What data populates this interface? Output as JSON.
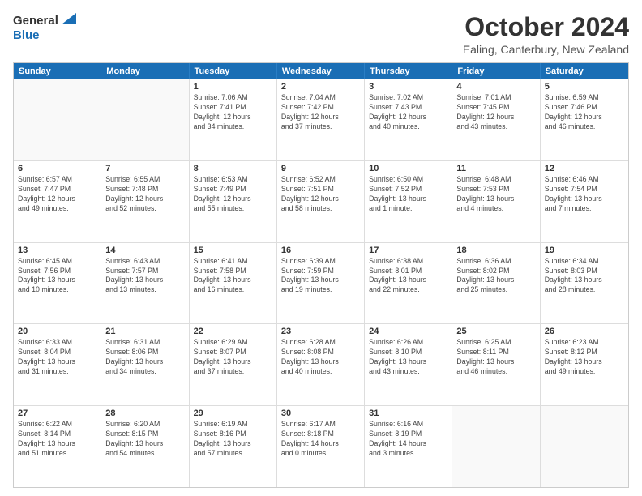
{
  "header": {
    "logo_general": "General",
    "logo_blue": "Blue",
    "month_title": "October 2024",
    "location": "Ealing, Canterbury, New Zealand"
  },
  "weekdays": [
    "Sunday",
    "Monday",
    "Tuesday",
    "Wednesday",
    "Thursday",
    "Friday",
    "Saturday"
  ],
  "rows": [
    [
      {
        "day": "",
        "info": ""
      },
      {
        "day": "",
        "info": ""
      },
      {
        "day": "1",
        "info": "Sunrise: 7:06 AM\nSunset: 7:41 PM\nDaylight: 12 hours\nand 34 minutes."
      },
      {
        "day": "2",
        "info": "Sunrise: 7:04 AM\nSunset: 7:42 PM\nDaylight: 12 hours\nand 37 minutes."
      },
      {
        "day": "3",
        "info": "Sunrise: 7:02 AM\nSunset: 7:43 PM\nDaylight: 12 hours\nand 40 minutes."
      },
      {
        "day": "4",
        "info": "Sunrise: 7:01 AM\nSunset: 7:45 PM\nDaylight: 12 hours\nand 43 minutes."
      },
      {
        "day": "5",
        "info": "Sunrise: 6:59 AM\nSunset: 7:46 PM\nDaylight: 12 hours\nand 46 minutes."
      }
    ],
    [
      {
        "day": "6",
        "info": "Sunrise: 6:57 AM\nSunset: 7:47 PM\nDaylight: 12 hours\nand 49 minutes."
      },
      {
        "day": "7",
        "info": "Sunrise: 6:55 AM\nSunset: 7:48 PM\nDaylight: 12 hours\nand 52 minutes."
      },
      {
        "day": "8",
        "info": "Sunrise: 6:53 AM\nSunset: 7:49 PM\nDaylight: 12 hours\nand 55 minutes."
      },
      {
        "day": "9",
        "info": "Sunrise: 6:52 AM\nSunset: 7:51 PM\nDaylight: 12 hours\nand 58 minutes."
      },
      {
        "day": "10",
        "info": "Sunrise: 6:50 AM\nSunset: 7:52 PM\nDaylight: 13 hours\nand 1 minute."
      },
      {
        "day": "11",
        "info": "Sunrise: 6:48 AM\nSunset: 7:53 PM\nDaylight: 13 hours\nand 4 minutes."
      },
      {
        "day": "12",
        "info": "Sunrise: 6:46 AM\nSunset: 7:54 PM\nDaylight: 13 hours\nand 7 minutes."
      }
    ],
    [
      {
        "day": "13",
        "info": "Sunrise: 6:45 AM\nSunset: 7:56 PM\nDaylight: 13 hours\nand 10 minutes."
      },
      {
        "day": "14",
        "info": "Sunrise: 6:43 AM\nSunset: 7:57 PM\nDaylight: 13 hours\nand 13 minutes."
      },
      {
        "day": "15",
        "info": "Sunrise: 6:41 AM\nSunset: 7:58 PM\nDaylight: 13 hours\nand 16 minutes."
      },
      {
        "day": "16",
        "info": "Sunrise: 6:39 AM\nSunset: 7:59 PM\nDaylight: 13 hours\nand 19 minutes."
      },
      {
        "day": "17",
        "info": "Sunrise: 6:38 AM\nSunset: 8:01 PM\nDaylight: 13 hours\nand 22 minutes."
      },
      {
        "day": "18",
        "info": "Sunrise: 6:36 AM\nSunset: 8:02 PM\nDaylight: 13 hours\nand 25 minutes."
      },
      {
        "day": "19",
        "info": "Sunrise: 6:34 AM\nSunset: 8:03 PM\nDaylight: 13 hours\nand 28 minutes."
      }
    ],
    [
      {
        "day": "20",
        "info": "Sunrise: 6:33 AM\nSunset: 8:04 PM\nDaylight: 13 hours\nand 31 minutes."
      },
      {
        "day": "21",
        "info": "Sunrise: 6:31 AM\nSunset: 8:06 PM\nDaylight: 13 hours\nand 34 minutes."
      },
      {
        "day": "22",
        "info": "Sunrise: 6:29 AM\nSunset: 8:07 PM\nDaylight: 13 hours\nand 37 minutes."
      },
      {
        "day": "23",
        "info": "Sunrise: 6:28 AM\nSunset: 8:08 PM\nDaylight: 13 hours\nand 40 minutes."
      },
      {
        "day": "24",
        "info": "Sunrise: 6:26 AM\nSunset: 8:10 PM\nDaylight: 13 hours\nand 43 minutes."
      },
      {
        "day": "25",
        "info": "Sunrise: 6:25 AM\nSunset: 8:11 PM\nDaylight: 13 hours\nand 46 minutes."
      },
      {
        "day": "26",
        "info": "Sunrise: 6:23 AM\nSunset: 8:12 PM\nDaylight: 13 hours\nand 49 minutes."
      }
    ],
    [
      {
        "day": "27",
        "info": "Sunrise: 6:22 AM\nSunset: 8:14 PM\nDaylight: 13 hours\nand 51 minutes."
      },
      {
        "day": "28",
        "info": "Sunrise: 6:20 AM\nSunset: 8:15 PM\nDaylight: 13 hours\nand 54 minutes."
      },
      {
        "day": "29",
        "info": "Sunrise: 6:19 AM\nSunset: 8:16 PM\nDaylight: 13 hours\nand 57 minutes."
      },
      {
        "day": "30",
        "info": "Sunrise: 6:17 AM\nSunset: 8:18 PM\nDaylight: 14 hours\nand 0 minutes."
      },
      {
        "day": "31",
        "info": "Sunrise: 6:16 AM\nSunset: 8:19 PM\nDaylight: 14 hours\nand 3 minutes."
      },
      {
        "day": "",
        "info": ""
      },
      {
        "day": "",
        "info": ""
      }
    ]
  ]
}
